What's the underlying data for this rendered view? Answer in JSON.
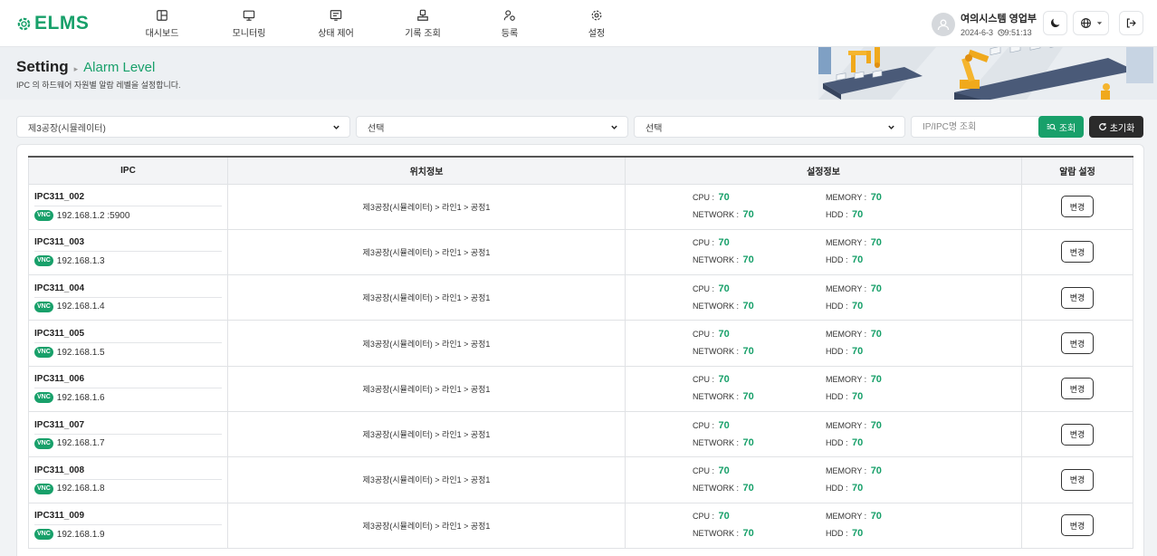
{
  "app": {
    "logo": "ELMS"
  },
  "nav": [
    {
      "label": "대시보드",
      "icon": "layout-icon"
    },
    {
      "label": "모니터링",
      "icon": "monitor-icon"
    },
    {
      "label": "상태 제어",
      "icon": "status-control-icon"
    },
    {
      "label": "기록 조회",
      "icon": "record-icon"
    },
    {
      "label": "등록",
      "icon": "register-icon"
    },
    {
      "label": "설정",
      "icon": "gear-icon"
    }
  ],
  "user": {
    "name": "여의시스템 영업부",
    "date": "2024-6-3",
    "time": "9:51:13"
  },
  "page": {
    "title": "Setting",
    "breadcrumb": "Alarm Level",
    "subtitle": "IPC 의 하드웨어 자원별 알람 레벨을 설정합니다."
  },
  "filters": {
    "factory": "제3공장(시뮬레이터)",
    "line": "선택",
    "process": "선택",
    "search_placeholder": "IP/IPC명 조회",
    "search_label": "조회",
    "reset_label": "초기화"
  },
  "table": {
    "headers": [
      "IPC",
      "위치정보",
      "설정정보",
      "알람 설정"
    ],
    "labels": {
      "vnc": "VNC",
      "cpu": "CPU : ",
      "memory": "MEMORY : ",
      "network": "NETWORK : ",
      "hdd": "HDD : ",
      "change": "변경"
    },
    "rows": [
      {
        "name": "IPC311_002",
        "ip": "192.168.1.2 :5900",
        "location": "제3공장(시뮬레이터) > 라인1 > 공정1",
        "cpu": "70",
        "memory": "70",
        "network": "70",
        "hdd": "70"
      },
      {
        "name": "IPC311_003",
        "ip": "192.168.1.3",
        "location": "제3공장(시뮬레이터) > 라인1 > 공정1",
        "cpu": "70",
        "memory": "70",
        "network": "70",
        "hdd": "70"
      },
      {
        "name": "IPC311_004",
        "ip": "192.168.1.4",
        "location": "제3공장(시뮬레이터) > 라인1 > 공정1",
        "cpu": "70",
        "memory": "70",
        "network": "70",
        "hdd": "70"
      },
      {
        "name": "IPC311_005",
        "ip": "192.168.1.5",
        "location": "제3공장(시뮬레이터) > 라인1 > 공정1",
        "cpu": "70",
        "memory": "70",
        "network": "70",
        "hdd": "70"
      },
      {
        "name": "IPC311_006",
        "ip": "192.168.1.6",
        "location": "제3공장(시뮬레이터) > 라인1 > 공정1",
        "cpu": "70",
        "memory": "70",
        "network": "70",
        "hdd": "70"
      },
      {
        "name": "IPC311_007",
        "ip": "192.168.1.7",
        "location": "제3공장(시뮬레이터) > 라인1 > 공정1",
        "cpu": "70",
        "memory": "70",
        "network": "70",
        "hdd": "70"
      },
      {
        "name": "IPC311_008",
        "ip": "192.168.1.8",
        "location": "제3공장(시뮬레이터) > 라인1 > 공정1",
        "cpu": "70",
        "memory": "70",
        "network": "70",
        "hdd": "70"
      },
      {
        "name": "IPC311_009",
        "ip": "192.168.1.9",
        "location": "제3공장(시뮬레이터) > 라인1 > 공정1",
        "cpu": "70",
        "memory": "70",
        "network": "70",
        "hdd": "70"
      }
    ]
  },
  "colors": {
    "accent": "#18a06a",
    "dark_button": "#2b2b2b"
  }
}
